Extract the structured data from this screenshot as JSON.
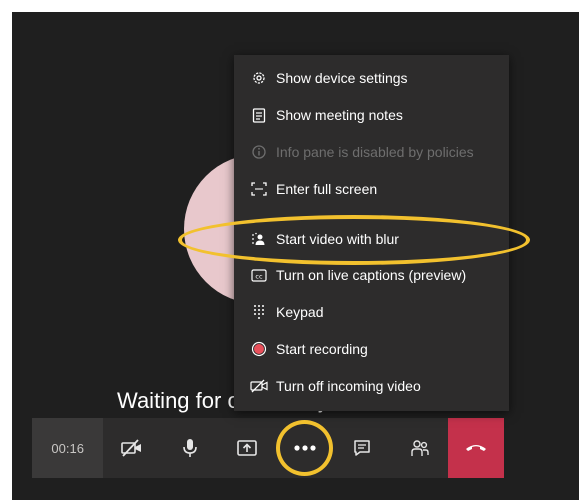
{
  "stage": {
    "waiting_text": "Waiting for others to join..."
  },
  "menu": {
    "items": [
      {
        "label": "Show device settings",
        "icon": "gear-icon",
        "enabled": true
      },
      {
        "label": "Show meeting notes",
        "icon": "notes-icon",
        "enabled": true
      },
      {
        "label": "Info pane is disabled by policies",
        "icon": "info-icon",
        "enabled": false
      },
      {
        "label": "Enter full screen",
        "icon": "fullscreen-icon",
        "enabled": true
      },
      {
        "label": "Start video with blur",
        "icon": "blur-icon",
        "enabled": true
      },
      {
        "label": "Turn on live captions (preview)",
        "icon": "captions-icon",
        "enabled": true
      },
      {
        "label": "Keypad",
        "icon": "keypad-icon",
        "enabled": true
      },
      {
        "label": "Start recording",
        "icon": "record-icon",
        "enabled": true
      },
      {
        "label": "Turn off incoming video",
        "icon": "video-off-icon",
        "enabled": true
      }
    ]
  },
  "controls": {
    "timer": "00:16",
    "buttons": [
      {
        "icon": "camera-off-icon"
      },
      {
        "icon": "microphone-icon"
      },
      {
        "icon": "share-screen-icon"
      },
      {
        "icon": "more-options-icon"
      },
      {
        "icon": "chat-icon"
      },
      {
        "icon": "participants-icon"
      },
      {
        "icon": "hang-up-icon"
      }
    ]
  },
  "colors": {
    "background": "#1f1f1f",
    "menu": "#2d2c2c",
    "hangup": "#c4314b",
    "record_dot": "#e8505b",
    "highlight": "#f2c12e",
    "avatar": "#e8c8cc"
  }
}
